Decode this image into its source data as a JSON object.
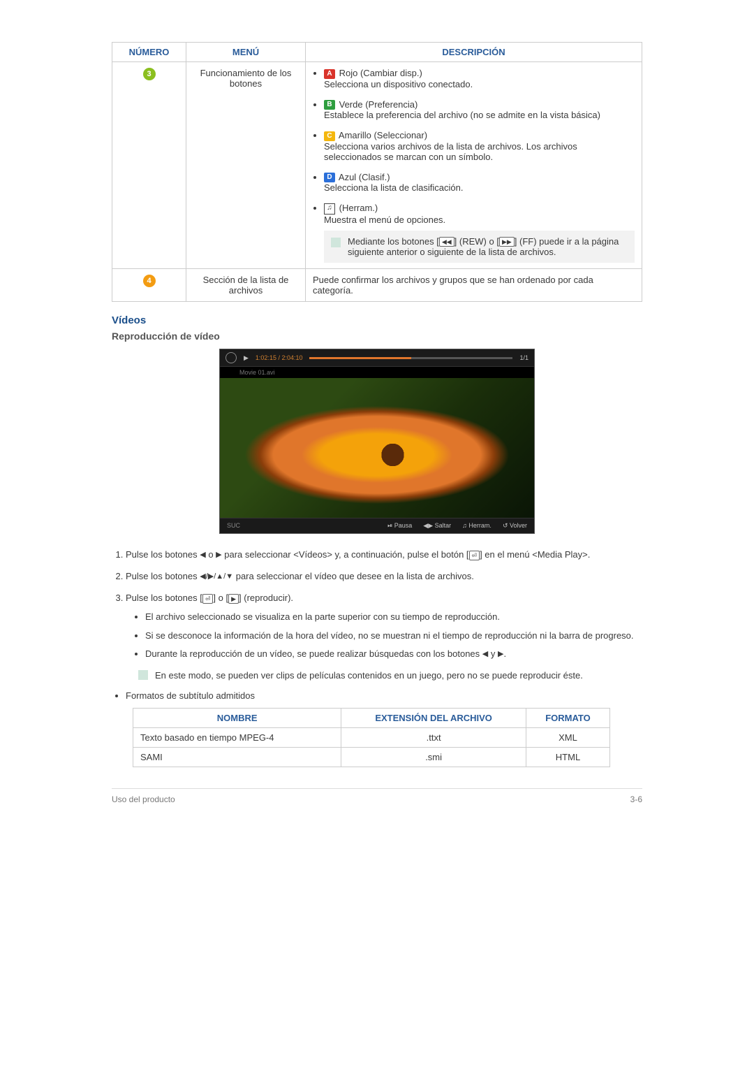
{
  "table_main": {
    "headers": {
      "numero": "NÚMERO",
      "menu": "MENÚ",
      "desc": "DESCRIPCIÓN"
    },
    "row3": {
      "num": "3",
      "menu": "Funcionamiento de los botones",
      "red_label": "A",
      "red_title": "Rojo (Cambiar disp.)",
      "red_desc": "Selecciona un dispositivo conectado.",
      "green_label": "B",
      "green_title": "Verde (Preferencia)",
      "green_desc": "Establece la preferencia del archivo (no se admite en la vista básica)",
      "yellow_label": "C",
      "yellow_title": "Amarillo (Seleccionar)",
      "yellow_desc": "Selecciona varios archivos de la lista de archivos. Los archivos seleccionados se marcan con un símbolo.",
      "blue_label": "D",
      "blue_title": "Azul (Clasif.)",
      "blue_desc": "Selecciona la lista de clasificación.",
      "tools_title": "(Herram.)",
      "tools_desc": "Muestra el menú de opciones.",
      "note_pre": "Mediante los botones [",
      "note_mid": "] (REW) o [",
      "note_post": "] (FF) puede ir a la página siguiente anterior o siguiente de la lista de archivos."
    },
    "row4": {
      "num": "4",
      "menu": "Sección de la lista de archivos",
      "desc": "Puede confirmar los archivos y grupos que se han ordenado por cada categoría."
    }
  },
  "section_videos": "Vídeos",
  "subsection_repro": "Reproducción de vídeo",
  "player": {
    "time": "1:02:15 / 2:04:10",
    "page": "1/1",
    "file": "Movie 01.avi",
    "left_label": "SUC",
    "pausa": "Pausa",
    "saltar": "Saltar",
    "herram": "Herram.",
    "volver": "Volver"
  },
  "steps": {
    "s1a": "Pulse los botones ",
    "s1b": " o ",
    "s1c": " para seleccionar <Vídeos> y, a continuación, pulse el botón [",
    "s1d": "] en el menú <Media Play>.",
    "s2a": "Pulse los botones ",
    "s2b": " para seleccionar el vídeo que desee en la lista de archivos.",
    "s3a": "Pulse los botones [",
    "s3b": "] o [",
    "s3c": "] (reproducir).",
    "s3_sub1": "El archivo seleccionado se visualiza en la parte superior con su tiempo de reproducción.",
    "s3_sub2": "Si se desconoce la información de la hora del vídeo, no se muestran ni el tiempo de reproducción ni la barra de progreso.",
    "s3_sub3a": "Durante la reproducción de un vídeo, se puede realizar búsquedas con los botones ",
    "s3_sub3b": " y ",
    "s3_sub3c": ".",
    "s3_note": "En este modo, se pueden ver clips de películas contenidos en un juego, pero no se puede reproducir éste."
  },
  "subtitle_intro": "Formatos de subtítulo admitidos",
  "fmt_table": {
    "h_nombre": "NOMBRE",
    "h_ext": "EXTENSIÓN DEL ARCHIVO",
    "h_fmt": "FORMATO",
    "rows": [
      {
        "nombre": "Texto basado en tiempo MPEG-4",
        "ext": ".ttxt",
        "fmt": "XML"
      },
      {
        "nombre": "SAMI",
        "ext": ".smi",
        "fmt": "HTML"
      }
    ]
  },
  "footer": {
    "left": "Uso del producto",
    "right": "3-6"
  }
}
